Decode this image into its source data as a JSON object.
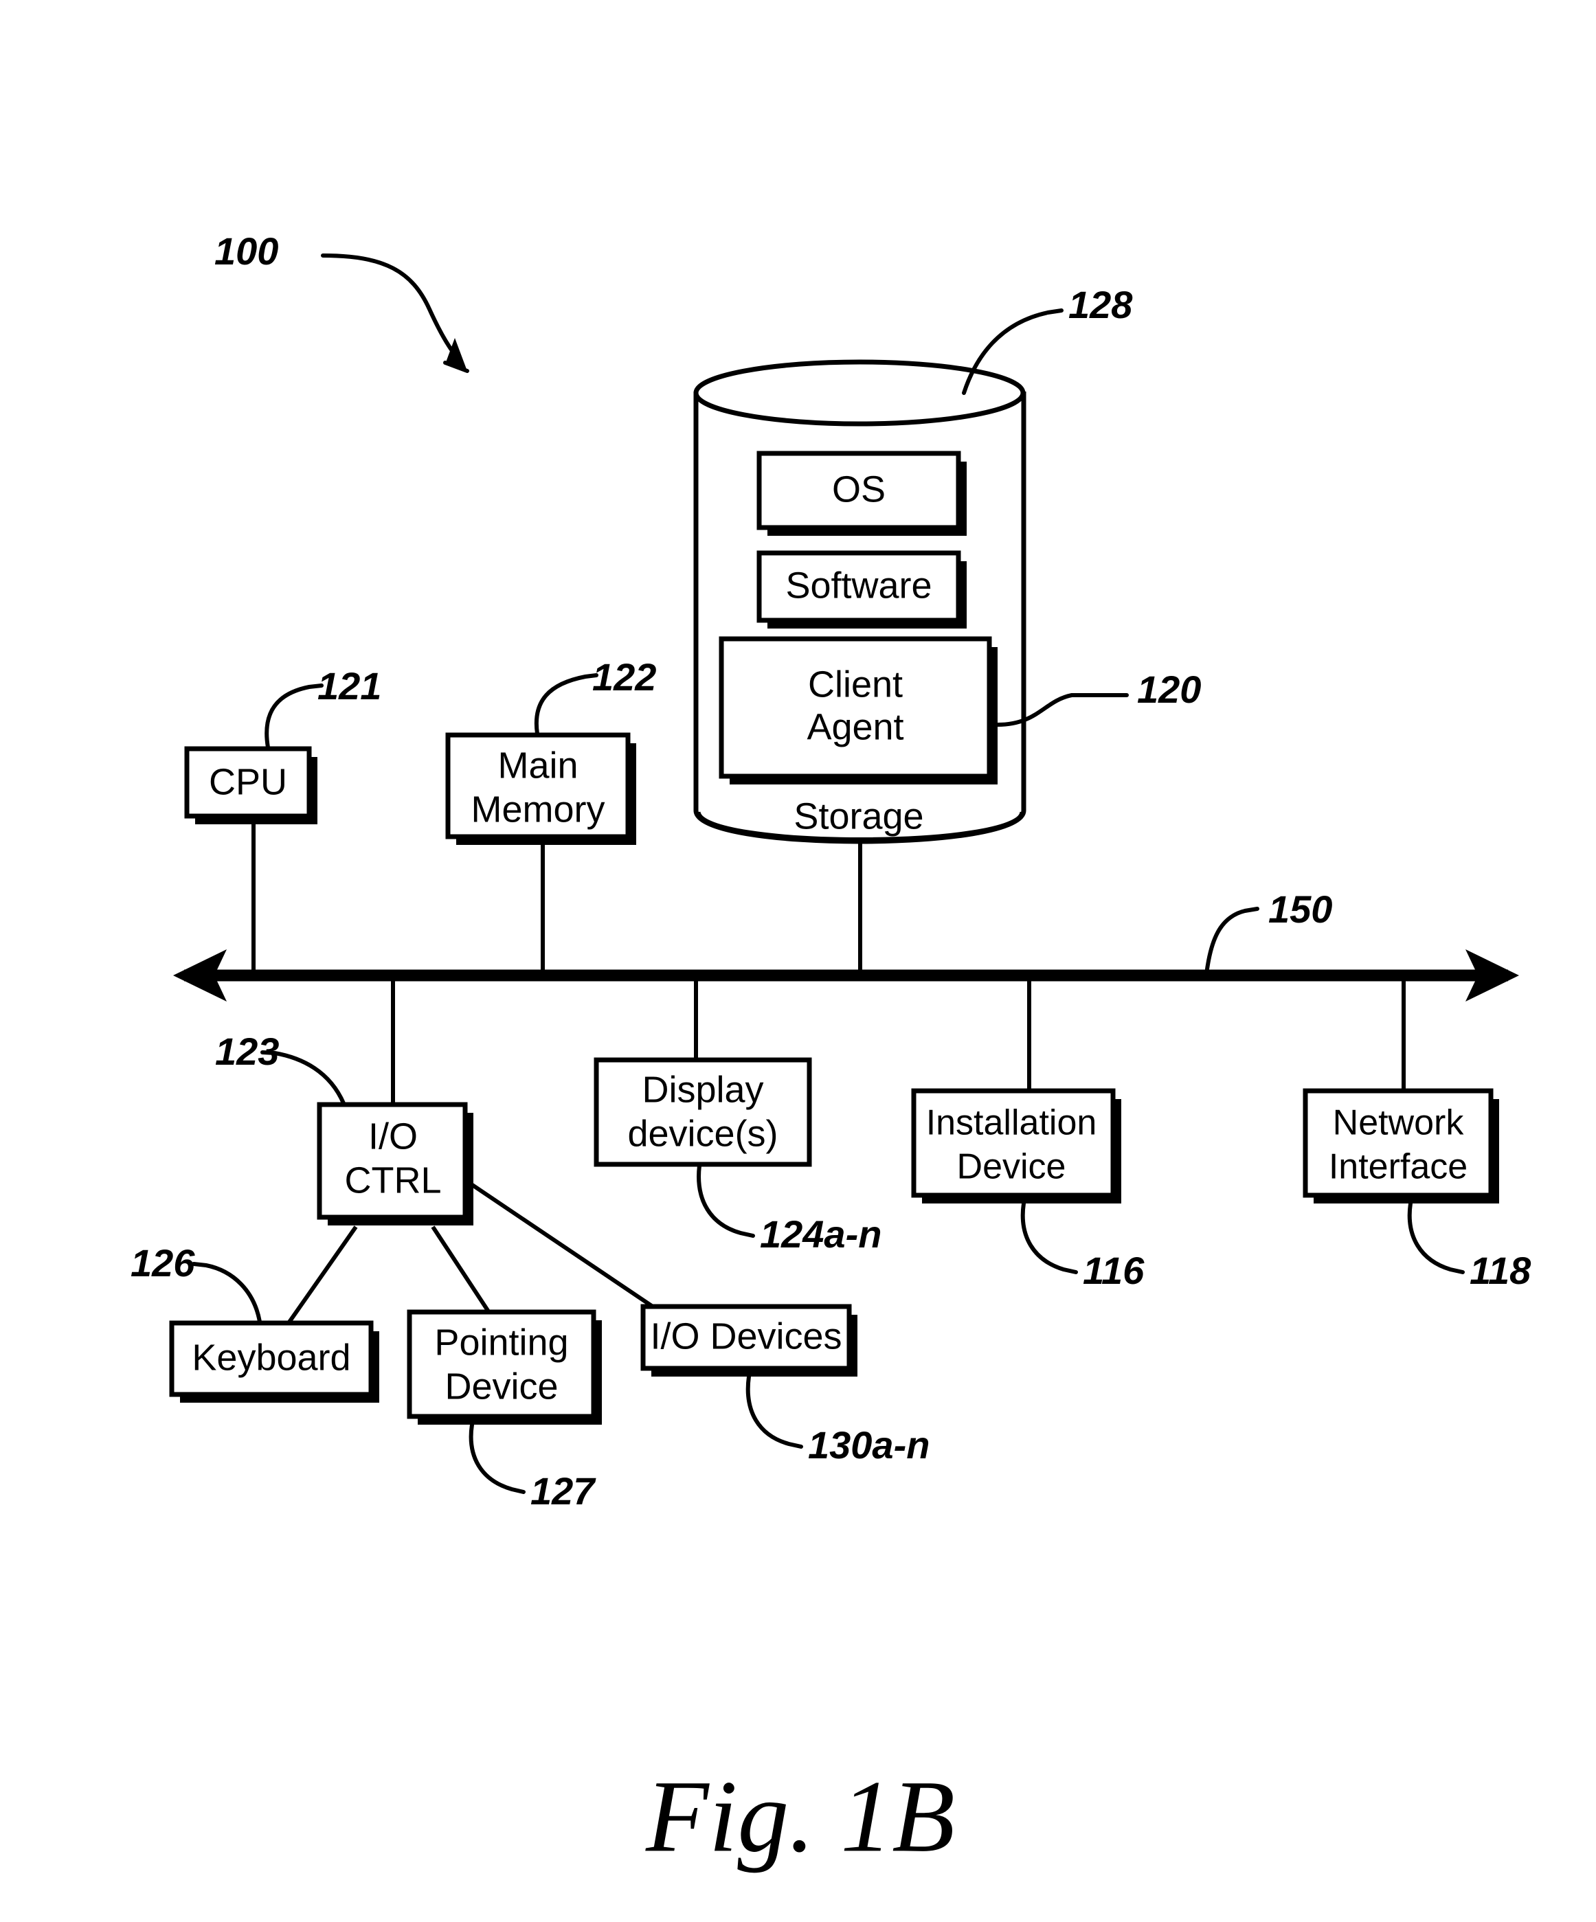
{
  "figure": {
    "caption": "Fig.  1B",
    "system_ref": "100"
  },
  "storage": {
    "cylinder_label": "Storage",
    "cylinder_ref": "128",
    "items": [
      {
        "label": "OS"
      },
      {
        "label": "Software"
      },
      {
        "label": "Client\nAgent",
        "line1": "Client",
        "line2": "Agent",
        "ref": "120"
      }
    ]
  },
  "bus": {
    "ref": "150"
  },
  "components": {
    "cpu": {
      "label": "CPU",
      "ref": "121"
    },
    "main_memory": {
      "line1": "Main",
      "line2": "Memory",
      "ref": "122"
    },
    "io_ctrl": {
      "line1": "I/O",
      "line2": "CTRL",
      "ref": "123"
    },
    "display": {
      "line1": "Display",
      "line2": "device(s)",
      "ref": "124a-n"
    },
    "installation": {
      "line1": "Installation",
      "line2": "Device",
      "ref": "116"
    },
    "network": {
      "line1": "Network",
      "line2": "Interface",
      "ref": "118"
    },
    "keyboard": {
      "label": "Keyboard",
      "ref": "126"
    },
    "pointing": {
      "line1": "Pointing",
      "line2": "Device",
      "ref": "127"
    },
    "io_devices": {
      "label": "I/O Devices",
      "ref": "130a-n"
    }
  },
  "colors": {
    "line": "#000000",
    "background": "#ffffff"
  }
}
